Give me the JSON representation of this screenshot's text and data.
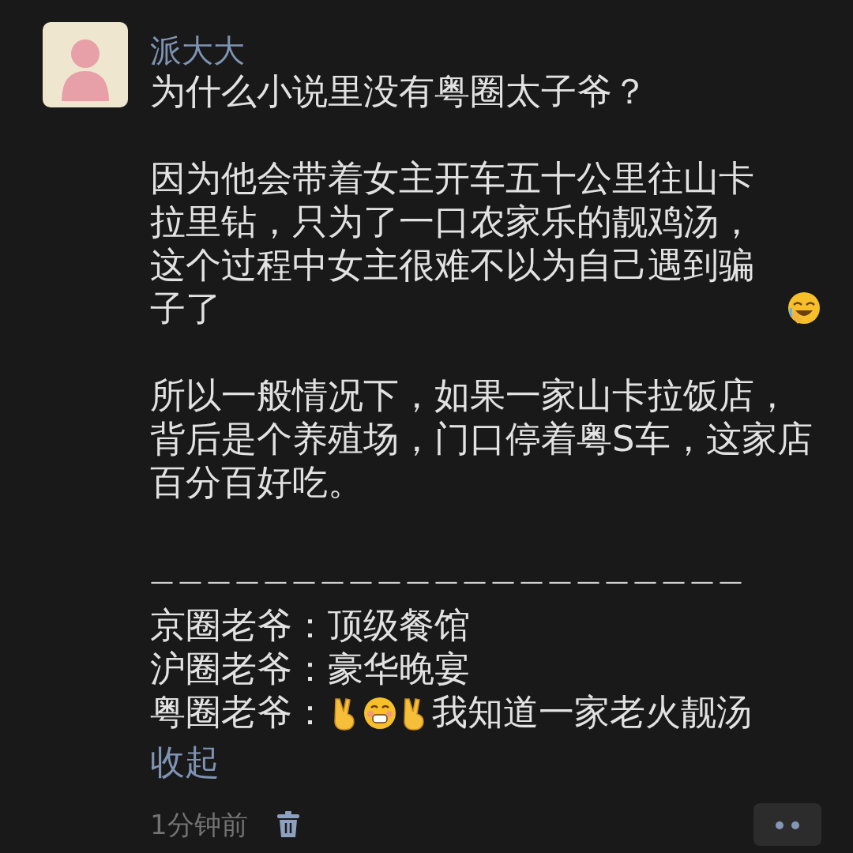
{
  "post": {
    "author": "派大大",
    "title": "为什么小说里没有粤圈太子爷？",
    "paragraphs": [
      "因为他会带着女主开车五十公里往山卡拉里钻，只为了一口农家乐的靓鸡汤，这个过程中女主很难不以为自己遇到骗子了",
      "所以一般情况下，如果一家山卡拉饭店，背后是个养殖场，门口停着粤S车，这家店百分百好吃。"
    ],
    "divider": "—————————————————————",
    "rankings": [
      {
        "label": "京圈老爷：",
        "text": "顶级餐馆"
      },
      {
        "label": "沪圈老爷：",
        "text": "豪华晚宴"
      },
      {
        "label": "粤圈老爷：",
        "text": "我知道一家老火靓汤"
      }
    ],
    "collapse_link": "收起",
    "time": "1分钟前"
  }
}
